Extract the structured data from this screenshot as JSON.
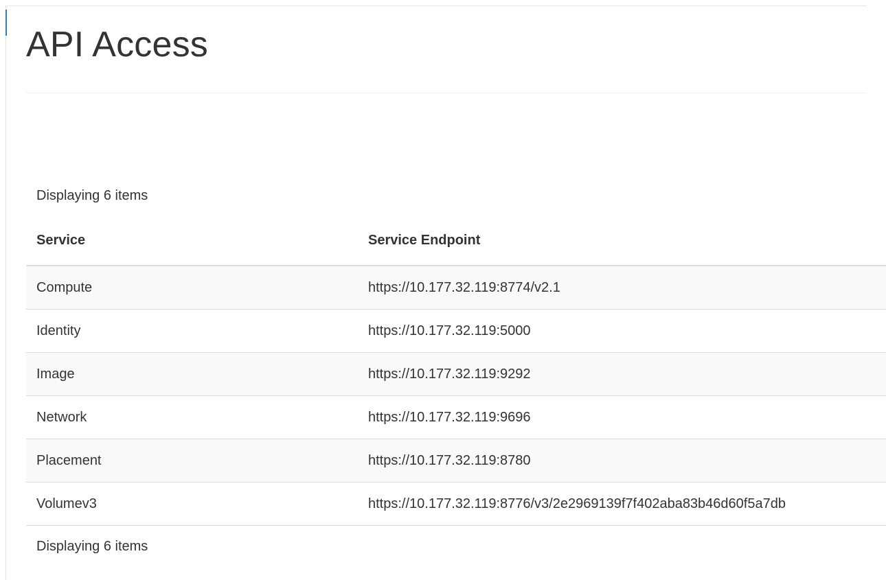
{
  "page": {
    "title": "API Access"
  },
  "table": {
    "count_top": "Displaying 6 items",
    "count_bottom": "Displaying 6 items",
    "columns": [
      "Service",
      "Service Endpoint"
    ],
    "rows": [
      {
        "service": "Compute",
        "endpoint": "https://10.177.32.119:8774/v2.1"
      },
      {
        "service": "Identity",
        "endpoint": "https://10.177.32.119:5000"
      },
      {
        "service": "Image",
        "endpoint": "https://10.177.32.119:9292"
      },
      {
        "service": "Network",
        "endpoint": "https://10.177.32.119:9696"
      },
      {
        "service": "Placement",
        "endpoint": "https://10.177.32.119:8780"
      },
      {
        "service": "Volumev3",
        "endpoint": "https://10.177.32.119:8776/v3/2e2969139f7f402aba83b46d60f5a7db"
      }
    ]
  },
  "colors": {
    "stripe": "#f9f9f9",
    "border": "#dddddd",
    "text": "#333333",
    "focus_accent": "#2f79c4"
  }
}
